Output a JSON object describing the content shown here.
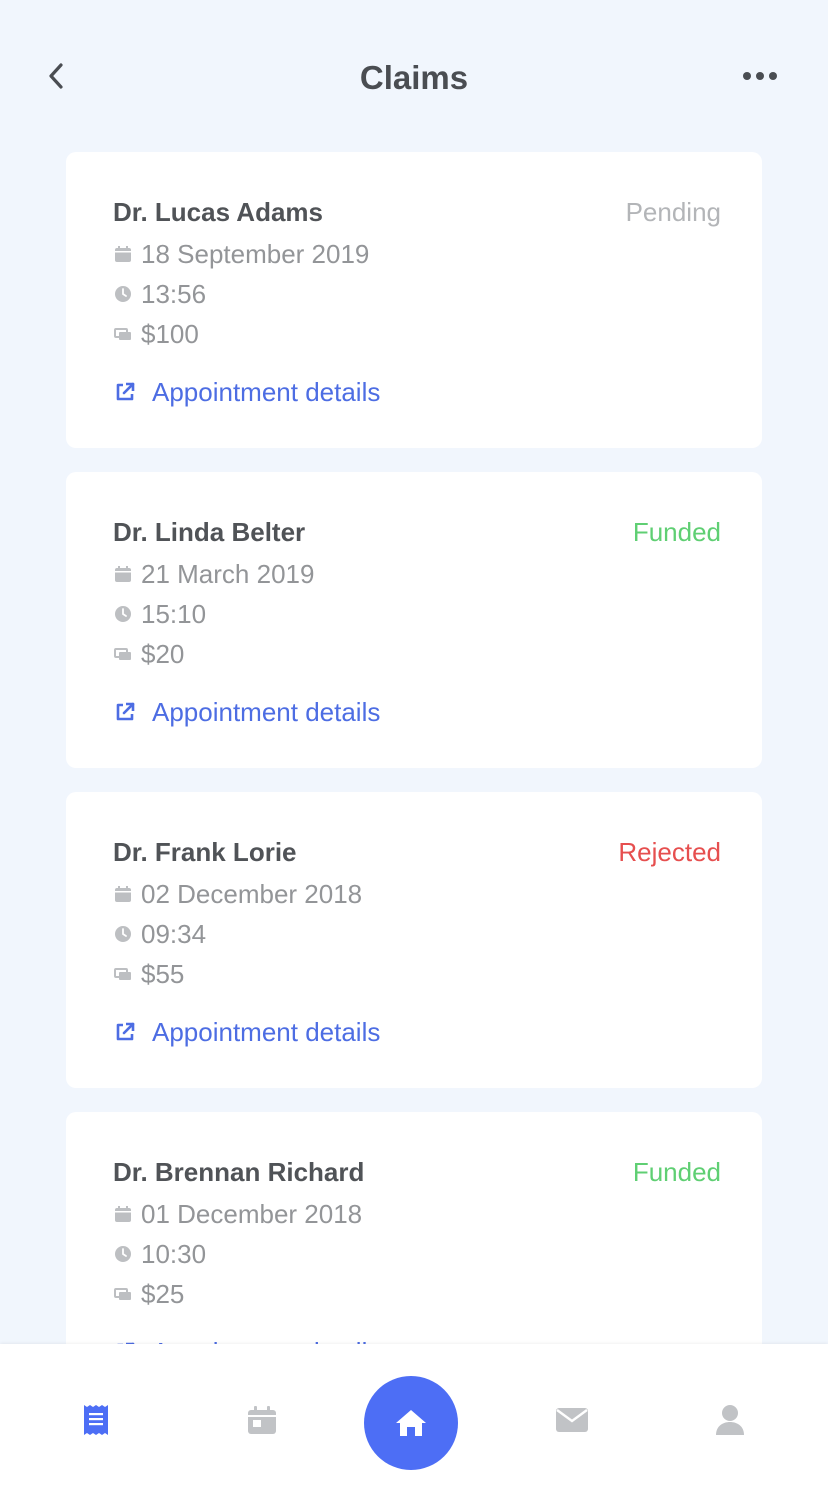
{
  "header": {
    "title": "Claims",
    "back_icon": "chevron-left-icon",
    "more_icon": "more-horizontal-icon"
  },
  "colors": {
    "pending": "#b3b5b8",
    "funded": "#5fcf73",
    "rejected": "#e64f4f",
    "link": "#4d6de3",
    "accent": "#4d6ef5"
  },
  "claims": [
    {
      "doctor": "Dr. Lucas Adams",
      "status": "Pending",
      "date": "18 September 2019",
      "time": "13:56",
      "amount": "$100",
      "link": "Appointment details"
    },
    {
      "doctor": "Dr. Linda Belter",
      "status": "Funded",
      "date": "21 March 2019",
      "time": "15:10",
      "amount": "$20",
      "link": "Appointment details"
    },
    {
      "doctor": "Dr. Frank Lorie",
      "status": "Rejected",
      "date": "02 December 2018",
      "time": "09:34",
      "amount": "$55",
      "link": "Appointment details"
    },
    {
      "doctor": "Dr. Brennan Richard",
      "status": "Funded",
      "date": "01 December 2018",
      "time": "10:30",
      "amount": "$25",
      "link": "Appointment details"
    }
  ],
  "tabbar": {
    "items": [
      "receipt-icon",
      "calendar-icon",
      "home-icon",
      "mail-icon",
      "user-icon"
    ],
    "active": "receipt-icon"
  }
}
